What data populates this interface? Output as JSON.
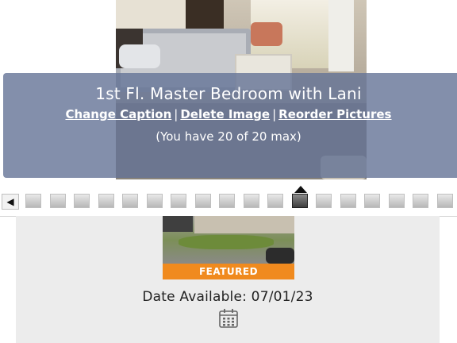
{
  "viewer": {
    "caption": "1st Fl. Master Bedroom with Lani",
    "links": {
      "change_caption": "Change Caption",
      "delete_image": "Delete Image",
      "reorder_pictures": "Reorder Pictures",
      "separator": "|"
    },
    "count_text": "(You have 20 of 20 max)"
  },
  "strip": {
    "prev_icon": "rewind-icon",
    "prev_glyph": "◀",
    "thumbnail_count": 19,
    "active_index": 11
  },
  "listing": {
    "featured_label": "FEATURED",
    "date_available": "Date Available: 07/01/23",
    "calendar_icon": "calendar-icon",
    "featured_color": "#f08a1e"
  }
}
